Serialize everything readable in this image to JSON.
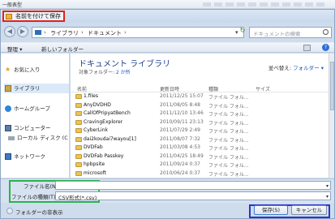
{
  "outer": {
    "title": "一般表型"
  },
  "dialog": {
    "title": "名前を付けて保存"
  },
  "address": {
    "crumbs": [
      "ライブラリ",
      "ドキュメント"
    ],
    "search_placeholder": "ドキュメントの検索"
  },
  "toolbar": {
    "organize": "整理 ▾",
    "new_folder": "新しいフォルダー"
  },
  "nav": {
    "items": [
      {
        "label": "お気に入り",
        "icon": "star-icon"
      },
      {
        "label": "ライブラリ",
        "icon": "library-icon"
      },
      {
        "label": "ホームグループ",
        "icon": "homegroup-icon"
      },
      {
        "label": "コンピューター",
        "icon": "computer-icon"
      },
      {
        "label": "ローカル ディスク (C",
        "icon": "disk-icon"
      },
      {
        "label": "ネットワーク",
        "icon": "network-icon"
      }
    ]
  },
  "content": {
    "library_title": "ドキュメント ライブラリ",
    "target_prefix": "対象フォルダー:",
    "target_count": "2 か所",
    "arrange_label": "並べ替え:",
    "arrange_value": "フォルダー ▾",
    "columns": {
      "name": "名前",
      "date": "更新日時",
      "type": "種類",
      "size": "サイズ"
    },
    "rows": [
      {
        "name": "1.files",
        "date": "2011/12/25 15:07",
        "type": "ファイル フォル..."
      },
      {
        "name": "AnyDVDHD",
        "date": "2011/08/05 8:48",
        "type": "ファイル フォル..."
      },
      {
        "name": "CallOfPripyatBench",
        "date": "2011/12/10 13:46",
        "type": "ファイル フォル..."
      },
      {
        "name": "CravingExplorer",
        "date": "2010/09/11 23:13",
        "type": "ファイル フォル..."
      },
      {
        "name": "CyberLink",
        "date": "2011/07/29 2:49",
        "type": "ファイル フォル..."
      },
      {
        "name": "dai2koudai7wayou[1]",
        "date": "2011/08/07 7:32",
        "type": "ファイル フォル..."
      },
      {
        "name": "DVDFab",
        "date": "2011/03/08 4:53",
        "type": "ファイル フォル..."
      },
      {
        "name": "DVDFab Passkey",
        "date": "2011/04/25 18:49",
        "type": "ファイル フォル..."
      },
      {
        "name": "hpbpsite",
        "date": "2011/09/24 0:37",
        "type": "ファイル フォル..."
      },
      {
        "name": "microsoft",
        "date": "2010/06/24 0:37",
        "type": "ファイル フォル..."
      }
    ]
  },
  "fields": {
    "filename_label": "ファイル名(N):",
    "filename_value": "",
    "filetype_label": "ファイルの種類(T):",
    "filetype_value": "CSV形式(*.csv)"
  },
  "bottom": {
    "hide_folders": "フォルダーの非表示",
    "save": "保存(S)",
    "cancel": "キャンセル"
  },
  "colors": {
    "highlight_red": "#e2231a",
    "highlight_green": "#2bb34a",
    "highlight_blue": "#2a35c9"
  }
}
